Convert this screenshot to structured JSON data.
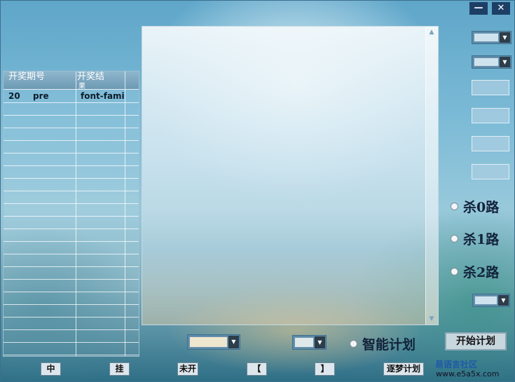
{
  "window": {
    "minimize": "—",
    "close": "✕"
  },
  "history_table": {
    "columns": [
      "开奖期号",
      "开奖结",
      "果"
    ],
    "rows": [
      {
        "period": "20",
        "field": "pre",
        "result": "font-fami"
      }
    ]
  },
  "right_panel": {
    "kill_options": [
      "杀0路",
      "杀1路",
      "杀2路"
    ]
  },
  "bottom": {
    "smart_plan_label": "智能计划",
    "start_plan_label": "开始计划",
    "buttons": [
      "中",
      "挂",
      "未开",
      "【",
      "】",
      "逐梦计划"
    ],
    "watermark_line1": "易语言社区",
    "watermark_line2": "www.e5a5x.com"
  }
}
